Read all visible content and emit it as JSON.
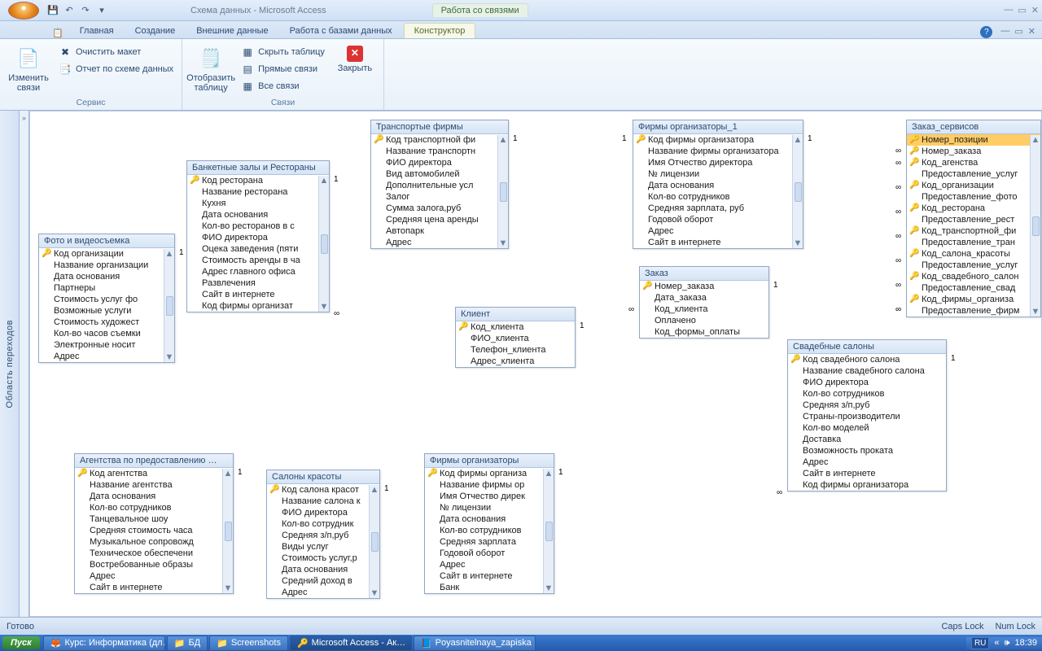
{
  "title": "Схема данных - Microsoft Access",
  "context_tab_group": "Работа со связями",
  "ribbon_tabs": [
    "Главная",
    "Создание",
    "Внешние данные",
    "Работа с базами данных",
    "Конструктор"
  ],
  "ribbon": {
    "g1": {
      "label": "Сервис",
      "edit": "Изменить связи",
      "clear": "Очистить макет",
      "report": "Отчет по схеме данных"
    },
    "g2": {
      "label": "Связи",
      "show_table": "Отобразить таблицу",
      "hide": "Скрыть таблицу",
      "direct": "Прямые связи",
      "all": "Все связи",
      "close": "Закрыть"
    }
  },
  "navpane": "Область переходов",
  "status": {
    "ready": "Готово",
    "caps": "Caps Lock",
    "num": "Num Lock"
  },
  "taskbar": {
    "start": "Пуск",
    "items": [
      "Курс: Информатика (дл…",
      "БД",
      "Screenshots",
      "Microsoft Access - Ак…",
      "Poyasnitelnaya_zapiska …"
    ],
    "lang": "RU",
    "time": "18:39"
  },
  "tables": {
    "photo": {
      "title": "Фото и видеосъемка",
      "fields": [
        "Код организации",
        "Название организации",
        "Дата основания",
        "Партнеры",
        "Стоимость услуг фо",
        "Возможные услуги",
        "Стоимость художест",
        "Кол-во часов съемки",
        "Электронные носит",
        "Адрес"
      ],
      "keys": [
        0
      ]
    },
    "banquet": {
      "title": "Банкетные залы и Рестораны",
      "fields": [
        "Код ресторана",
        "Название ресторана",
        "Кухня",
        "Дата основания",
        "Кол-во ресторанов в с",
        "ФИО директора",
        "Оцека заведения (пяти",
        "Стоимость аренды в ча",
        "Адрес главного офиса",
        "Развлечения",
        "Сайт в интернете",
        "Код фирмы организат"
      ],
      "keys": [
        0
      ]
    },
    "transport": {
      "title": "Транспортые фирмы",
      "fields": [
        "Код транспортной фи",
        "Название транспортн",
        "ФИО директора",
        "Вид автомобилей",
        "Дополнительные усл",
        "Залог",
        "Сумма залога,руб",
        "Средняя цена аренды",
        "Автопарк",
        "Адрес"
      ],
      "keys": [
        0
      ]
    },
    "org1": {
      "title": "Фирмы организаторы_1",
      "fields": [
        "Код фирмы организатора",
        "Название фирмы организатора",
        "Имя Отчество директора",
        "№ лицензии",
        "Дата основания",
        "Кол-во сотрудников",
        "Средняя зарплата, руб",
        "Годовой оборот",
        "Адрес",
        "Сайт в интернете"
      ],
      "keys": [
        0
      ]
    },
    "services": {
      "title": "Заказ_сервисов",
      "fields": [
        "Номер_позиции",
        "Номер_заказа",
        "Код_агенства",
        "Предоставление_услуг",
        "Код_организации",
        "Предоставление_фото",
        "Код_ресторана",
        "Предоставление_рест",
        "Код_транспортной_фи",
        "Предоставление_тран",
        "Код_салона_красоты",
        "Предоставление_услуг",
        "Код_свадебного_салон",
        "Предоставление_свад",
        "Код_фирмы_организа",
        "Предоставление_фирм"
      ],
      "keys": [
        0,
        1,
        2,
        4,
        6,
        8,
        10,
        12,
        14
      ]
    },
    "client": {
      "title": "Клиент",
      "fields": [
        "Код_клиента",
        "ФИО_клиента",
        "Телефон_клиента",
        "Адрес_клиента"
      ],
      "keys": [
        0
      ]
    },
    "order": {
      "title": "Заказ",
      "fields": [
        "Номер_заказа",
        "Дата_заказа",
        "Код_клиента",
        "Оплачено",
        "Код_формы_оплаты"
      ],
      "keys": [
        0
      ]
    },
    "wedding": {
      "title": "Свадебные салоны",
      "fields": [
        "Код свадебного салона",
        "Название свадебного салона",
        "ФИО директора",
        "Кол-во сотрудников",
        "Средняя з/п,руб",
        "Страны-производители",
        "Кол-во моделей",
        "Доставка",
        "Возможность проката",
        "Адрес",
        "Сайт в интернете",
        "Код фирмы организатора"
      ],
      "keys": [
        0
      ]
    },
    "agency": {
      "title": "Агентства по предоставлению …",
      "fields": [
        "Код агентства",
        "Название агентства",
        "Дата основания",
        "Кол-во сотрудников",
        "Танцевальное шоу",
        "Средняя стоимость часа",
        "Музыкальное сопровожд",
        "Техническое обеспечени",
        "Востребованные образы",
        "Адрес",
        "Сайт в интернете"
      ],
      "keys": [
        0
      ]
    },
    "beauty": {
      "title": "Салоны красоты",
      "fields": [
        "Код салона красот",
        "Название салона к",
        "ФИО директора",
        "Кол-во сотрудник",
        "Средняя з/п,руб",
        "Виды услуг",
        "Стоимость услуг,р",
        "Дата основания",
        "Средний доход в",
        "Адрес"
      ],
      "keys": [
        0
      ]
    },
    "org": {
      "title": "Фирмы организаторы",
      "fields": [
        "Код фирмы организа",
        "Название фирмы ор",
        "Имя Отчество дирек",
        "№ лицензии",
        "Дата основания",
        "Кол-во сотрудников",
        "Средняя зарплата",
        "Годовой оборот",
        "Адрес",
        "Сайт в интернете",
        "Банк"
      ],
      "keys": [
        0
      ]
    }
  }
}
